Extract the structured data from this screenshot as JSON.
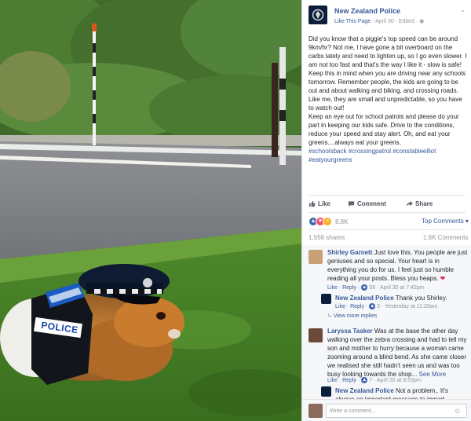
{
  "post": {
    "page_name": "New Zealand Police",
    "like_page": "Like This Page",
    "date": "April 30",
    "edited": "Edited",
    "paragraphs": [
      "Did you know that a piggie's top speed can be around 9km/hr? Not me, I have gone a bit overboard on the carbs lately and need to lighten up, so I go even slower. I am not too fast and that's the way I like it - slow is safe!",
      "Keep this in mind when you are driving near any schools tomorrow. Remember people, the kids are going to be out and about walking and biking, and crossing roads. Like me, they are small and unpredictable, so you have to watch out!",
      "Keep an eye out for school patrols and please do your part in keeping our kids safe. Drive to the conditions, reduce your speed and stay alert. Oh, and eat your greens....always eat your greens."
    ],
    "hashtags": [
      "#schoolsback",
      "#crossingpatrol",
      "#constableelliot",
      "#eatyourgreens"
    ]
  },
  "actions": {
    "like": "Like",
    "comment": "Comment",
    "share": "Share"
  },
  "reactions": {
    "count": "8.8K",
    "sort": "Top Comments"
  },
  "stats": {
    "shares": "1,556 shares",
    "comments": "1.6K Comments"
  },
  "comments": [
    {
      "name": "Shirley Garnett",
      "text": "Just love this. You people are just geniuses and so special. Your heart is in everything you do for us. I feel just so humble reading all your posts. Bless you heaps.",
      "like": "Like",
      "reply": "Reply",
      "likes": "58",
      "time": "April 30 at 7:42pm"
    },
    {
      "name": "New Zealand Police",
      "text": "Thank you Shirley.",
      "like": "Like",
      "reply": "Reply",
      "likes": "3",
      "time": "Yesterday at 11:20am"
    },
    {
      "view_more": "View more replies"
    },
    {
      "name": "Laryssa Tasker",
      "text": "Was at the base the other day walking over the zebra crossing and had to tell my son and mother to hurry because a woman came zooming around a blind bend. As she came closer we realised she still hadn't seen us and was too busy looking towards the shop...",
      "see_more": "See More",
      "like": "Like",
      "reply": "Reply",
      "likes": "7",
      "time": "April 30 at 8:53pm"
    },
    {
      "name": "New Zealand Police",
      "text": "Not a problem.. It's always an important message to impart"
    }
  ],
  "write": {
    "placeholder": "Write a comment..."
  },
  "photo": {
    "vest_text": "POLICE"
  },
  "colors": {
    "link": "#365899",
    "police_navy": "#0b1f3d",
    "reaction_like": "#4267b2",
    "reaction_love": "#f25268"
  }
}
